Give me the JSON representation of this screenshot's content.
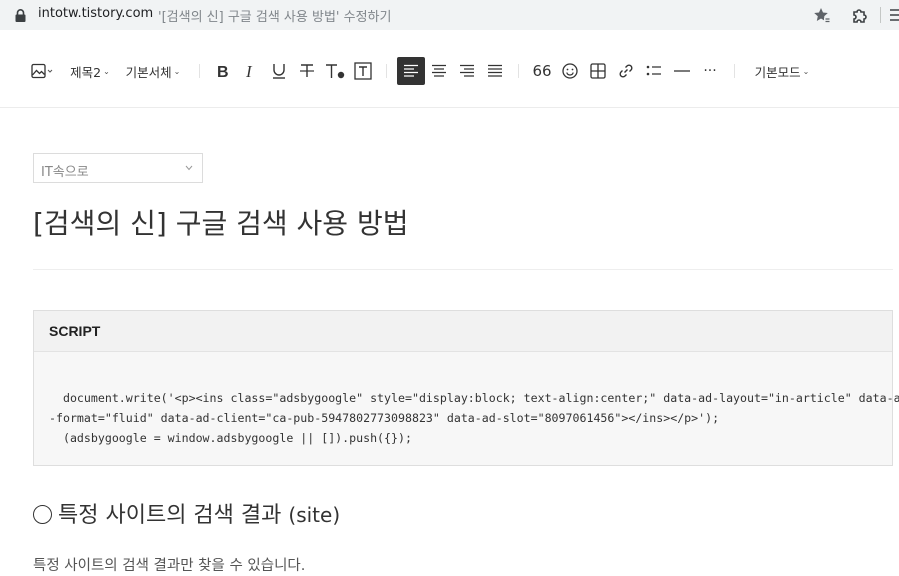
{
  "browser": {
    "url_host": "intotw.tistory.com",
    "url_title": "'[검색의 신] 구글 검색 사용 방법' 수정하기"
  },
  "toolbar": {
    "heading_label": "제목2",
    "font_label": "기본서체",
    "mode_label": "기본모드",
    "quote_label": "66",
    "more_label": "···"
  },
  "editor": {
    "category": "IT속으로",
    "title": "[검색의 신] 구글 검색 사용 방법",
    "script_block": {
      "label": "SCRIPT",
      "lines": [
        "  document.write('<p><ins class=\"adsbygoogle\" style=\"display:block; text-align:center;\" data-ad-layout=\"in-article\" data-ad",
        "-format=\"fluid\" data-ad-client=\"ca-pub-5947802773098823\" data-ad-slot=\"8097061456\"></ins></p>');",
        "  (adsbygoogle = window.adsbygoogle || []).push({});"
      ]
    },
    "heading": {
      "text": "특정 사이트의 검색 결과",
      "suffix": "(site)"
    },
    "paragraph": "특정 사이트의 검색 결과만 찾을 수 있습니다."
  },
  "colors": {
    "accent_active": "#333333",
    "address_bar_bg": "#f1f3f4",
    "code_bg": "#f7f7f7"
  }
}
